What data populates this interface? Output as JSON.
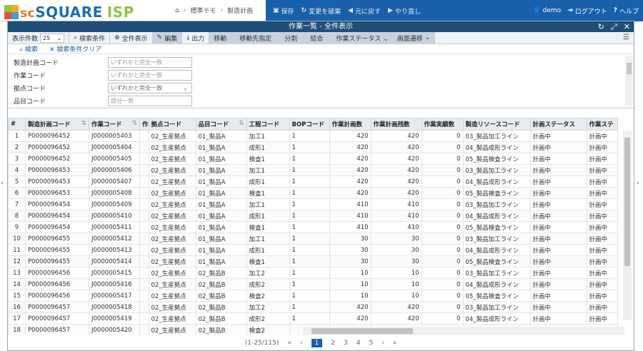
{
  "app": {
    "logo_sc": "sc",
    "logo_square": "SQUARE",
    "logo_isp": "ISP"
  },
  "breadcrumb": {
    "item1": "標準テモ",
    "item2": "製造計画"
  },
  "topnav": {
    "save": "保存",
    "reload": "変更を破棄",
    "undo": "元に戻す",
    "redo": "やり直し"
  },
  "user": {
    "name": "demo",
    "logout": "ログアウト",
    "help": "ヘルプ"
  },
  "window": {
    "title": "作業一覧 - 全件表示"
  },
  "toolbar": {
    "page_size_label": "表示件数",
    "page_size": "25",
    "search_cond": "検索条件",
    "show_all": "全件表示",
    "edit": "編集",
    "output": "出力",
    "move": "移動",
    "move_to": "移動先指定",
    "split": "分割",
    "merge": "結合",
    "work_status": "作業ステータス",
    "screen_transition": "画面遷移"
  },
  "search_bar": {
    "search": "検索",
    "clear": "検索条件クリア"
  },
  "filters": [
    {
      "label": "製造計画コード",
      "placeholder": "いずれかと完全一致"
    },
    {
      "label": "作業コード",
      "placeholder": "いずれかと完全一致"
    },
    {
      "label": "拠点コード",
      "placeholder": "いずれかと完全一致"
    },
    {
      "label": "品目コード",
      "placeholder": "部分一致"
    }
  ],
  "table": {
    "headers": [
      "#",
      "製造計画コード",
      "作業コード",
      "作",
      "拠点コード",
      "品目コード",
      "工程コード",
      "BOPコード",
      "作業計画数",
      "作業計画残数",
      "作業実績数",
      "製造リソースコード",
      "計画ステータス",
      "作業ステ"
    ],
    "rows": [
      [
        "1",
        "P0000096452",
        "J0000005403",
        "",
        "02_生産拠点",
        "01_製品A",
        "加工1",
        "1",
        "420",
        "420",
        "0",
        "03_製品加工ライン",
        "計画中",
        "計画中"
      ],
      [
        "2",
        "P0000096452",
        "J0000005404",
        "",
        "02_生産拠点",
        "01_製品A",
        "成形1",
        "1",
        "420",
        "420",
        "0",
        "04_製品成形ライン",
        "計画中",
        "計画中"
      ],
      [
        "3",
        "P0000096452",
        "J0000005405",
        "",
        "02_生産拠点",
        "01_製品A",
        "検査1",
        "1",
        "420",
        "420",
        "0",
        "05_製品検査ライン",
        "計画中",
        "計画中"
      ],
      [
        "4",
        "P0000096453",
        "J0000005406",
        "",
        "02_生産拠点",
        "01_製品A",
        "加工1",
        "1",
        "420",
        "420",
        "0",
        "03_製品加工ライン",
        "計画中",
        "計画中"
      ],
      [
        "5",
        "P0000096453",
        "J0000005407",
        "",
        "02_生産拠点",
        "01_製品A",
        "成形1",
        "1",
        "420",
        "420",
        "0",
        "04_製品成形ライン",
        "計画中",
        "計画中"
      ],
      [
        "6",
        "P0000096453",
        "J0000005408",
        "",
        "02_生産拠点",
        "01_製品A",
        "検査1",
        "1",
        "420",
        "420",
        "0",
        "05_製品検査ライン",
        "計画中",
        "計画中"
      ],
      [
        "7",
        "P0000096454",
        "J0000005409",
        "",
        "02_生産拠点",
        "01_製品A",
        "加工1",
        "1",
        "410",
        "410",
        "0",
        "03_製品加工ライン",
        "計画中",
        "計画中"
      ],
      [
        "8",
        "P0000096454",
        "J0000005410",
        "",
        "02_生産拠点",
        "01_製品A",
        "成形1",
        "1",
        "410",
        "410",
        "0",
        "04_製品成形ライン",
        "計画中",
        "計画中"
      ],
      [
        "9",
        "P0000096454",
        "J0000005411",
        "",
        "02_生産拠点",
        "01_製品A",
        "検査1",
        "1",
        "410",
        "410",
        "0",
        "05_製品検査ライン",
        "計画中",
        "計画中"
      ],
      [
        "10",
        "P0000096455",
        "J0000005412",
        "",
        "02_生産拠点",
        "01_製品A",
        "加工1",
        "1",
        "30",
        "30",
        "0",
        "03_製品加工ライン",
        "計画中",
        "計画中"
      ],
      [
        "11",
        "P0000096455",
        "J0000005413",
        "",
        "02_生産拠点",
        "01_製品A",
        "成形1",
        "1",
        "30",
        "30",
        "0",
        "04_製品成形ライン",
        "計画中",
        "計画中"
      ],
      [
        "12",
        "P0000096455",
        "J0000005414",
        "",
        "02_生産拠点",
        "01_製品A",
        "検査1",
        "1",
        "30",
        "30",
        "0",
        "05_製品検査ライン",
        "計画中",
        "計画中"
      ],
      [
        "13",
        "P0000096456",
        "J0000005415",
        "",
        "02_生産拠点",
        "02_製品B",
        "加工2",
        "1",
        "10",
        "10",
        "0",
        "03_製品加工ライン",
        "計画中",
        "計画中"
      ],
      [
        "14",
        "P0000096456",
        "J0000005416",
        "",
        "02_生産拠点",
        "02_製品B",
        "成形2",
        "1",
        "10",
        "10",
        "0",
        "04_製品成形ライン",
        "計画中",
        "計画中"
      ],
      [
        "15",
        "P0000096456",
        "J0000005417",
        "",
        "02_生産拠点",
        "02_製品B",
        "検査2",
        "1",
        "10",
        "10",
        "0",
        "05_製品検査ライン",
        "計画中",
        "計画中"
      ],
      [
        "16",
        "P0000096457",
        "J0000005418",
        "",
        "02_生産拠点",
        "02_製品B",
        "加工2",
        "1",
        "420",
        "420",
        "0",
        "03_製品加工ライン",
        "計画中",
        "計画中"
      ],
      [
        "17",
        "P0000096457",
        "J0000005419",
        "",
        "02_生産拠点",
        "02_製品B",
        "成形2",
        "1",
        "420",
        "420",
        "0",
        "04_製品成形ライン",
        "計画中",
        "計画中"
      ],
      [
        "18",
        "P0000096457",
        "J0000005420",
        "",
        "02_生産拠点",
        "02_製品B",
        "検査2",
        "",
        "",
        "",
        "",
        "",
        "",
        ""
      ]
    ]
  },
  "pager": {
    "range": "(1-25/115)",
    "pages": [
      "1",
      "2",
      "3",
      "4",
      "5"
    ],
    "first": "«",
    "prev": "‹",
    "next": "›",
    "last": "»"
  }
}
